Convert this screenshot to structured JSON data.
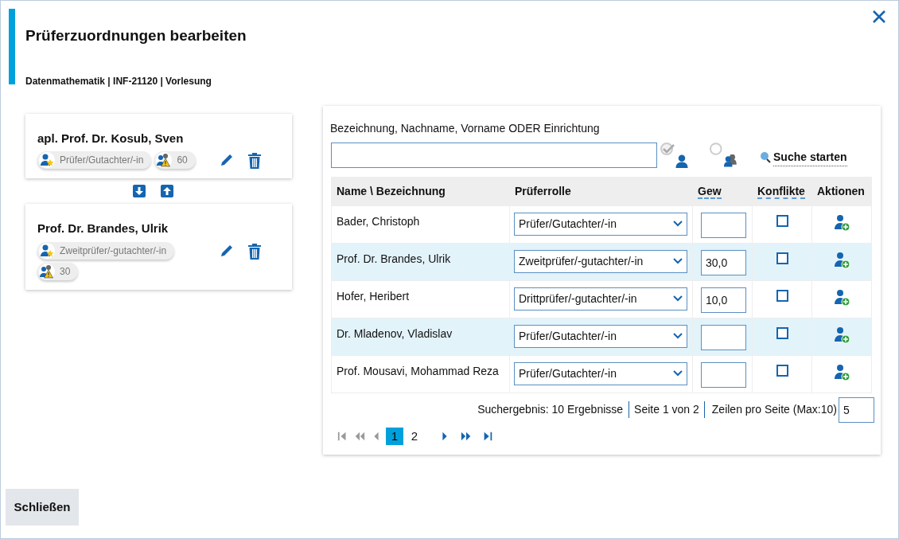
{
  "dialog": {
    "title": "Prüferzuordnungen bearbeiten",
    "subtitle": "Datenmathematik | INF-21120 | Vorlesung"
  },
  "assigned": [
    {
      "name": "apl. Prof. Dr. Kosub, Sven",
      "role": "Prüfer/Gutachter/-in",
      "weight": "60"
    },
    {
      "name": "Prof. Dr. Brandes, Ulrik",
      "role": "Zweitprüfer/-gutachter/-in",
      "weight": "30"
    }
  ],
  "search": {
    "label": "Bezeichnung, Nachname, Vorname ODER Einrichtung",
    "modes": [
      {
        "kind": "person",
        "selected": true
      },
      {
        "kind": "group",
        "selected": false
      }
    ],
    "button": "Suche starten"
  },
  "table": {
    "columns": [
      {
        "label": "Name \\ Bezeichnung",
        "hint": false
      },
      {
        "label": "Prüferrolle",
        "hint": false
      },
      {
        "label": "Gew",
        "hint": true
      },
      {
        "label": "Konflikte",
        "hint": true
      },
      {
        "label": "Aktionen",
        "hint": false
      }
    ],
    "rows": [
      {
        "name": "Bader, Christoph",
        "role": "Prüfer/Gutachter/-in",
        "weight": "",
        "conflict": false
      },
      {
        "name": "Prof. Dr. Brandes, Ulrik",
        "role": "Zweitprüfer/-gutachter/-in",
        "weight": "30,0",
        "conflict": false
      },
      {
        "name": "Hofer, Heribert",
        "role": "Drittprüfer/-gutachter/-in",
        "weight": "10,0",
        "conflict": false
      },
      {
        "name": "Dr. Mladenov, Vladislav",
        "role": "Prüfer/Gutachter/-in",
        "weight": "",
        "conflict": false
      },
      {
        "name": "Prof. Mousavi, Mohammad Reza",
        "role": "Prüfer/Gutachter/-in",
        "weight": "",
        "conflict": false
      }
    ]
  },
  "pager": {
    "result": "Suchergebnis: 10 Ergebnisse",
    "page_info": "Seite 1 von 2",
    "rows_label": "Zeilen pro Seite (Max:10)",
    "rows_value": "5",
    "nav": [
      {
        "kind": "first",
        "disabled": true
      },
      {
        "kind": "fast-back",
        "disabled": true
      },
      {
        "kind": "prev",
        "disabled": true
      },
      {
        "kind": "next",
        "disabled": false
      },
      {
        "kind": "fast-forward",
        "disabled": false
      },
      {
        "kind": "last",
        "disabled": false
      }
    ],
    "pages": [
      {
        "label": "1",
        "selected": true
      },
      {
        "label": "2",
        "selected": false
      }
    ]
  },
  "footer": {
    "close_button": "Schließen"
  }
}
